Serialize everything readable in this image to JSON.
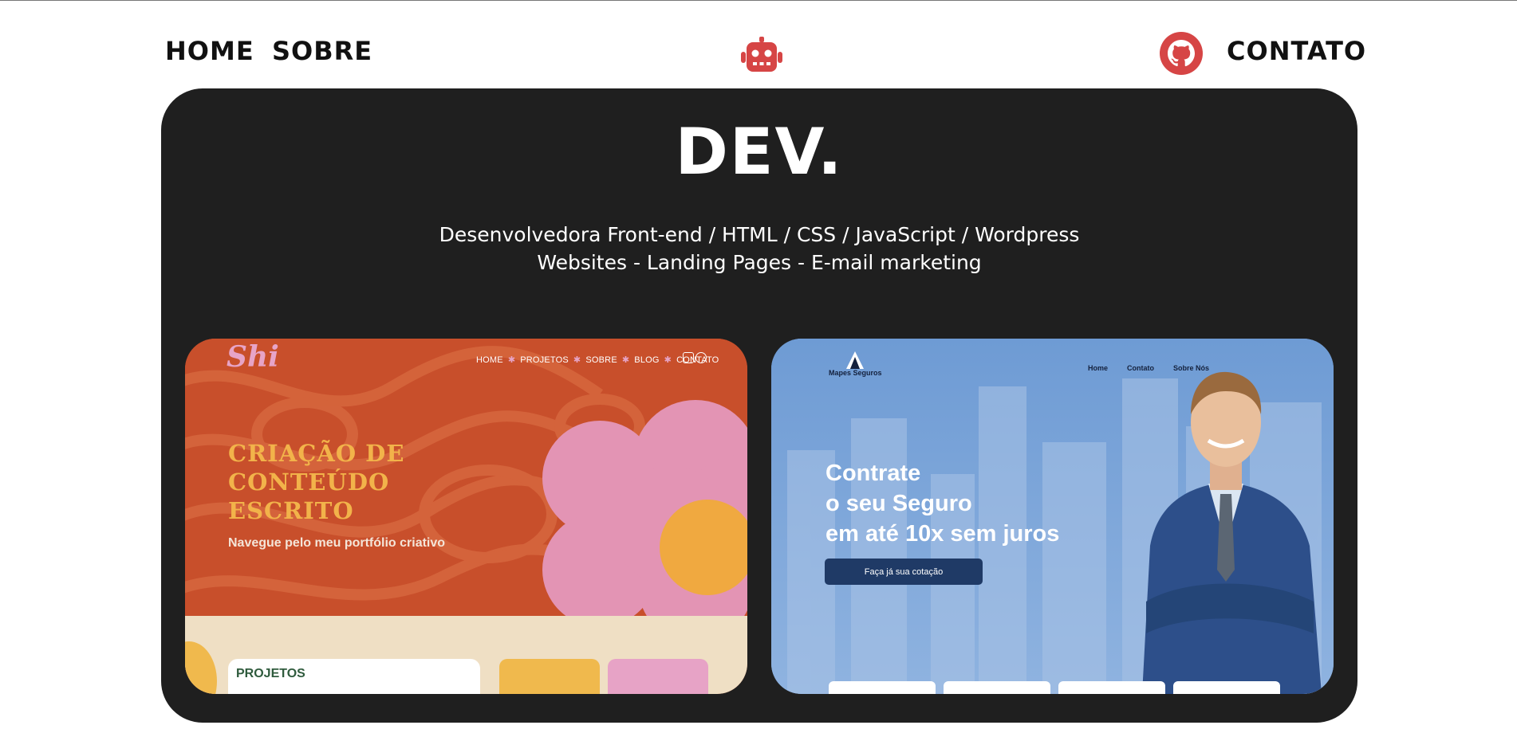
{
  "nav": {
    "home": "HOME",
    "sobre": "SOBRE",
    "contato": "CONTATO",
    "center_icon": "robot-icon",
    "github_icon": "github-icon"
  },
  "hero": {
    "brand": "DEV.",
    "subtitle_line1": "Desenvolvedora Front-end / HTML / CSS / JavaScript / Wordpress",
    "subtitle_line2": "Websites - Landing Pages - E-mail marketing"
  },
  "projects": [
    {
      "logo": "Shi",
      "menu": [
        "HOME",
        "PROJETOS",
        "SOBRE",
        "BLOG",
        "CONTATO"
      ],
      "menu_separator": "✱",
      "headline_lines": [
        "CRIAÇÃO DE",
        "CONTEÚDO",
        "ESCRITO"
      ],
      "tagline": "Navegue pelo meu portfólio criativo",
      "section_label": "PROJETOS"
    },
    {
      "logo_text": "Mapes Seguros",
      "menu": [
        "Home",
        "Contato",
        "Sobre Nós"
      ],
      "headline_lines": [
        "Contrate",
        "o seu Seguro",
        "em até 10x sem juros"
      ],
      "cta": "Faça já sua cotação"
    }
  ],
  "colors": {
    "hero_bg": "#1f1f1f",
    "accent_red": "#d64545",
    "card1_orange": "#c84f2b",
    "card1_yellow": "#f2b34a",
    "card1_pink": "#e7a4c7",
    "card2_navy": "#1f3a66"
  }
}
